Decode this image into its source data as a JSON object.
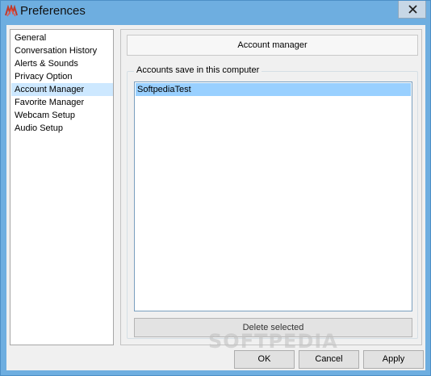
{
  "window": {
    "title": "Preferences",
    "icon": "app-logo-icon",
    "close_icon": "close-icon"
  },
  "sidebar": {
    "items": [
      {
        "label": "General",
        "selected": false
      },
      {
        "label": "Conversation History",
        "selected": false
      },
      {
        "label": "Alerts & Sounds",
        "selected": false
      },
      {
        "label": "Privacy Option",
        "selected": false
      },
      {
        "label": "Account Manager",
        "selected": true
      },
      {
        "label": "Favorite Manager",
        "selected": false
      },
      {
        "label": "Webcam Setup",
        "selected": false
      },
      {
        "label": "Audio Setup",
        "selected": false
      }
    ]
  },
  "panel": {
    "header_label": "Account manager",
    "group_label": "Accounts save in this computer",
    "accounts": [
      "SoftpediaTest"
    ],
    "delete_label": "Delete selected"
  },
  "watermark": "SOFTPEDIA",
  "footer": {
    "ok_label": "OK",
    "cancel_label": "Cancel",
    "apply_label": "Apply"
  },
  "colors": {
    "titlebar": "#6eaee0",
    "selection": "#cde8ff",
    "list_selection": "#99d0ff"
  }
}
